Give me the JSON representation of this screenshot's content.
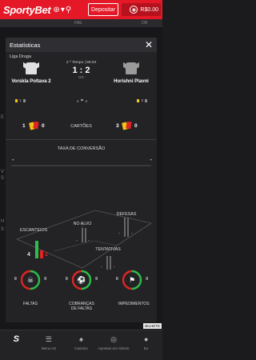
{
  "topbar": {
    "logo": "SportyBet",
    "icon_symbols": [
      "⊛",
      "▾",
      "⚲"
    ],
    "deposit_label": "Depositar",
    "balance_symbol": "◉",
    "balance_text": "R$0.00"
  },
  "background": {
    "tabs": [
      "",
      "",
      "FAE",
      "",
      "DR"
    ],
    "side_marks": [
      "E",
      "V",
      "S",
      "",
      "H",
      "S"
    ],
    "badge": "BILHETE"
  },
  "modal": {
    "title": "Estatísticas",
    "close_symbol": "✕",
    "league": "Liga Druga",
    "period": "2 º Tempo | 86:03",
    "score": "1 : 2",
    "aggregate": "0:0",
    "home": {
      "name": "Vorskla Poltava 2",
      "yellow": "1",
      "red": ""
    },
    "away": {
      "name": "Horishni Plavni",
      "yellow": "3",
      "red": ""
    },
    "mid_counts": {
      "left": "4",
      "right": "2"
    },
    "cards": {
      "label": "CARTÕES",
      "home_yellow": "1",
      "home_red": "0",
      "away_yellow": "3",
      "away_red": "0"
    },
    "conversion": {
      "label": "TAXA DE CONVERSÃO",
      "home": "-",
      "away": "-"
    },
    "attacks": {
      "escanteios": {
        "label": "ESCANTEIOS",
        "home": "4",
        "away": "2"
      },
      "no_alvo": {
        "label": "NO ALVO",
        "home": "-",
        "away": "-"
      },
      "defesas": {
        "label": "DEFESAS",
        "home": "-",
        "away": "-"
      },
      "tentativas": {
        "label": "TENTATIVAS",
        "home": "-",
        "away": "-"
      }
    },
    "gauges": [
      {
        "label": "FALTAS",
        "home": "0",
        "away": "0"
      },
      {
        "label": "COBRANÇAS DE FALTAS",
        "home": "0",
        "away": "0"
      },
      {
        "label": "IMPEDIMENTOS",
        "home": "0",
        "away": "0"
      }
    ]
  },
  "bottomnav": {
    "items": [
      {
        "label": "",
        "icon": "S"
      },
      {
        "label": "Menu AZ",
        "icon": "☰"
      },
      {
        "label": "Cassino",
        "icon": "♠"
      },
      {
        "label": "Apostas em Aberto",
        "icon": "◎"
      },
      {
        "label": "Eu",
        "icon": "●"
      }
    ]
  },
  "colors": {
    "brand_red": "#e41827",
    "yellow_card": "#f2c318",
    "red_card": "#e02424",
    "home_green": "#2fbd4a",
    "away_red": "#e02424"
  }
}
